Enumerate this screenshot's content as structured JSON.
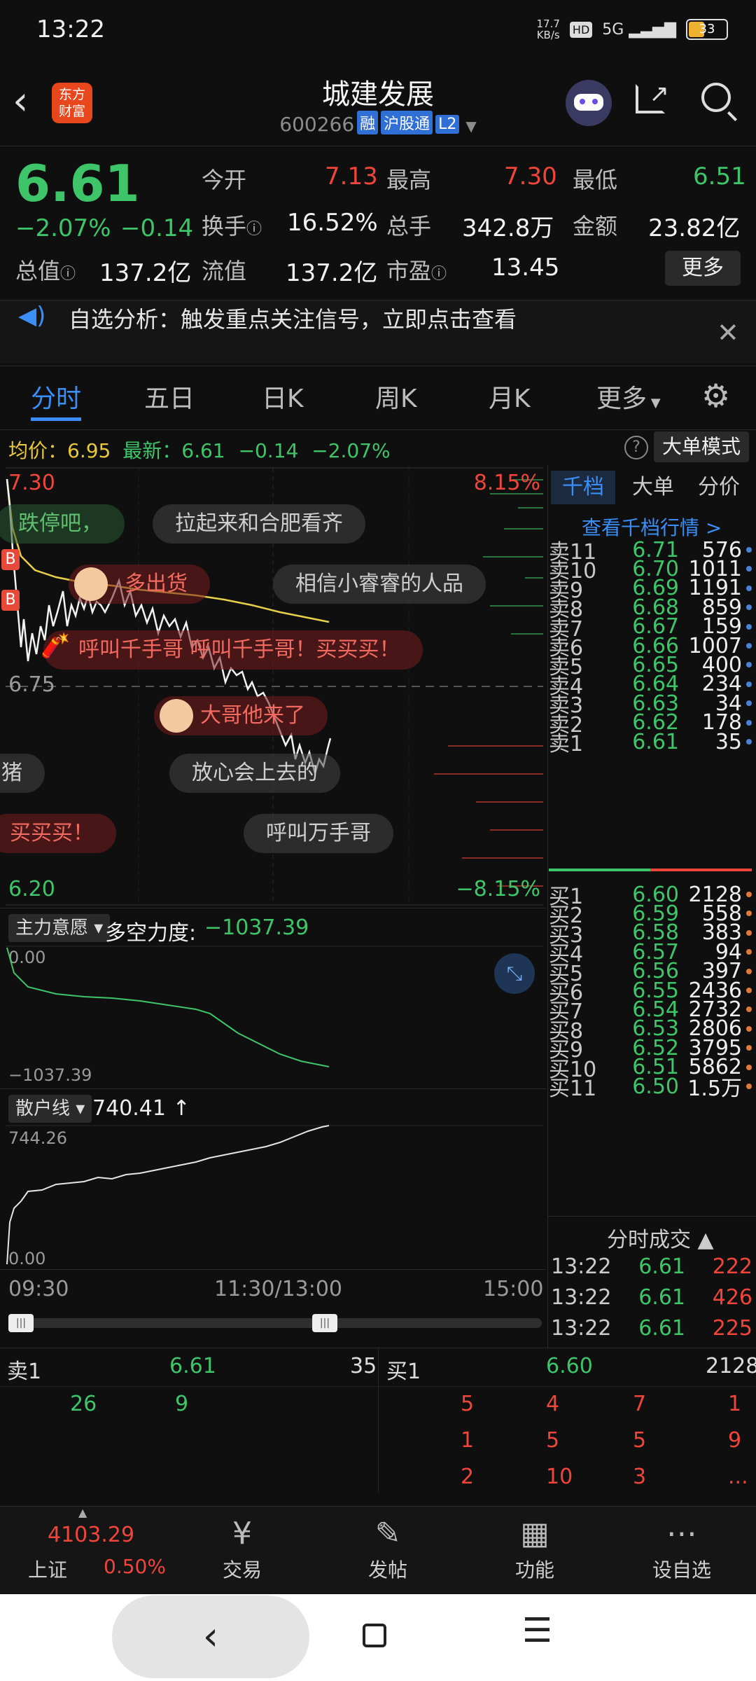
{
  "status": {
    "time": "13:22",
    "net": "17.7\nKB/s",
    "hd": "HD",
    "sig": "5G",
    "battery": "33"
  },
  "header": {
    "title": "城建发展",
    "code": "600266",
    "tags": [
      "融",
      "沪股通",
      "L2"
    ],
    "logo": "东方\n财富"
  },
  "quote": {
    "price": "6.61",
    "pct": "−2.07%",
    "chg": "−0.14",
    "cells": [
      {
        "label": "今开",
        "value": "7.13",
        "color": "red"
      },
      {
        "label": "最高",
        "value": "7.30",
        "color": "red"
      },
      {
        "label": "最低",
        "value": "6.51",
        "color": "green"
      },
      {
        "label": "换手",
        "value": "16.52%",
        "color": "white"
      },
      {
        "label": "总手",
        "value": "342.8万",
        "color": "white"
      },
      {
        "label": "金额",
        "value": "23.82亿",
        "color": "white"
      },
      {
        "label": "总值",
        "value": "137.2亿",
        "color": "white"
      },
      {
        "label": "流值",
        "value": "137.2亿",
        "color": "white"
      },
      {
        "label": "市盈",
        "value": "13.45",
        "color": "white"
      }
    ],
    "more": "更多"
  },
  "notice": {
    "text": "自选分析：触发重点关注信号，立即点击查看"
  },
  "tabs": [
    "分时",
    "五日",
    "日K",
    "周K",
    "月K",
    "更多"
  ],
  "info_line": {
    "avg_label": "均价：",
    "avg": "6.95",
    "latest_label": "最新：",
    "latest": "6.61",
    "chg": "−0.14",
    "pct": "−2.07%",
    "mode": "大单模式"
  },
  "chart": {
    "top_price": "7.30",
    "bottom_price": "6.20",
    "mid_price": "6.75",
    "top_pct": "8.15%",
    "bottom_pct": "−8.15%",
    "times": [
      "09:30",
      "11:30/13:00",
      "15:00"
    ]
  },
  "bubbles": [
    "跌停吧，",
    "拉起来和合肥看齐",
    "多出货",
    "相信小睿睿的人品",
    "呼叫千手哥 呼叫千手哥！买买买！",
    "大哥他来了",
    "猪",
    "放心会上去的",
    "买买买！",
    "呼叫万手哥"
  ],
  "indicator1": {
    "name": "主力意愿",
    "label": "多空力度:",
    "value": "−1037.39",
    "top": "0.00",
    "bottom": "−1037.39"
  },
  "indicator2": {
    "name": "散户线",
    "value": "740.41",
    "top": "744.26",
    "bottom": "0.00"
  },
  "book_tabs": [
    "千档",
    "大单",
    "分价"
  ],
  "book_link": "查看千档行情 >",
  "asks": [
    {
      "l": "卖11",
      "p": "6.71",
      "v": "576"
    },
    {
      "l": "卖10",
      "p": "6.70",
      "v": "1011"
    },
    {
      "l": "卖9",
      "p": "6.69",
      "v": "1191"
    },
    {
      "l": "卖8",
      "p": "6.68",
      "v": "859"
    },
    {
      "l": "卖7",
      "p": "6.67",
      "v": "159"
    },
    {
      "l": "卖6",
      "p": "6.66",
      "v": "1007"
    },
    {
      "l": "卖5",
      "p": "6.65",
      "v": "400"
    },
    {
      "l": "卖4",
      "p": "6.64",
      "v": "234"
    },
    {
      "l": "卖3",
      "p": "6.63",
      "v": "34"
    },
    {
      "l": "卖2",
      "p": "6.62",
      "v": "178"
    },
    {
      "l": "卖1",
      "p": "6.61",
      "v": "35"
    }
  ],
  "bids": [
    {
      "l": "买1",
      "p": "6.60",
      "v": "2128"
    },
    {
      "l": "买2",
      "p": "6.59",
      "v": "558"
    },
    {
      "l": "买3",
      "p": "6.58",
      "v": "383"
    },
    {
      "l": "买4",
      "p": "6.57",
      "v": "94"
    },
    {
      "l": "买5",
      "p": "6.56",
      "v": "397"
    },
    {
      "l": "买6",
      "p": "6.55",
      "v": "2436"
    },
    {
      "l": "买7",
      "p": "6.54",
      "v": "2732"
    },
    {
      "l": "买8",
      "p": "6.53",
      "v": "2806"
    },
    {
      "l": "买9",
      "p": "6.52",
      "v": "3795"
    },
    {
      "l": "买10",
      "p": "6.51",
      "v": "5862"
    },
    {
      "l": "买11",
      "p": "6.50",
      "v": "1.5万"
    }
  ],
  "ticks_title": "分时成交",
  "ticks": [
    {
      "t": "13:22",
      "p": "6.61",
      "v": "222"
    },
    {
      "t": "13:22",
      "p": "6.61",
      "v": "426"
    },
    {
      "t": "13:22",
      "p": "6.61",
      "v": "225"
    }
  ],
  "queue": {
    "sell_label": "卖1",
    "sell_price": "6.61",
    "sell_vol": "35",
    "sell_orders": [
      "26",
      "9"
    ],
    "buy_label": "买1",
    "buy_price": "6.60",
    "buy_vol": "2128",
    "buy_orders": [
      [
        "5",
        "4",
        "7",
        "1"
      ],
      [
        "1",
        "5",
        "5",
        "9"
      ],
      [
        "2",
        "10",
        "3",
        "..."
      ]
    ]
  },
  "bottom_nav": {
    "index_value": "4103.29",
    "index_name": "上证",
    "index_pct": "0.50%",
    "items": [
      "交易",
      "发帖",
      "功能",
      "设自选"
    ]
  }
}
